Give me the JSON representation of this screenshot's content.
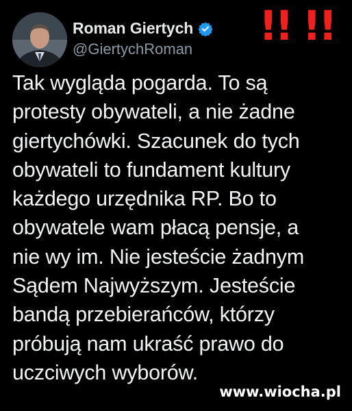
{
  "author": {
    "name": "Roman Giertych",
    "handle": "@GiertychRoman",
    "verified_icon": "verified-badge-icon",
    "badge_color": "#1d9bf0"
  },
  "annotation": {
    "text": "!! !!",
    "color": "#f2201c"
  },
  "post": {
    "lines": [
      "Tak wygląda pogarda. To są",
      "protesty obywateli, a nie żadne",
      "giertychówki. Szacunek do tych",
      "obywateli to fundament kultury",
      "każdego urzędnika RP. Bo to",
      "obywatele wam płacą pensje, a",
      "nie wy im. Nie jesteście żadnym",
      "Sądem Najwyższym. Jesteście",
      "bandą przebierańców, którzy",
      "próbują nam ukraść prawo do",
      "uczciwych wyborów."
    ]
  },
  "watermark": "www.wiocha.pl"
}
